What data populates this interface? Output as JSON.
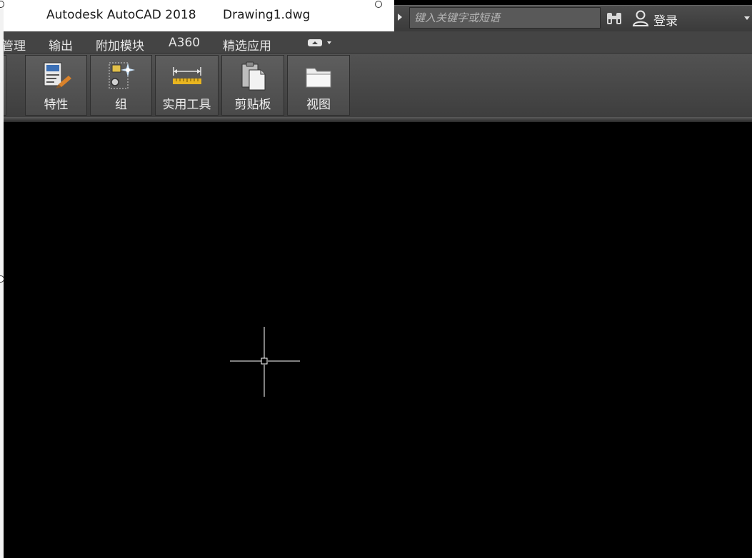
{
  "titlebar": {
    "app_title": "Autodesk AutoCAD 2018",
    "document_title": "Drawing1.dwg"
  },
  "search": {
    "placeholder": "键入关键字或短语"
  },
  "account": {
    "login_label": "登录"
  },
  "menu": {
    "items": [
      {
        "label": "管理"
      },
      {
        "label": "输出"
      },
      {
        "label": "附加模块"
      },
      {
        "label": "A360"
      },
      {
        "label": "精选应用"
      }
    ]
  },
  "ribbon": {
    "buttons": [
      {
        "label": "特性",
        "icon": "properties-icon"
      },
      {
        "label": "组",
        "icon": "group-icon"
      },
      {
        "label": "实用工具",
        "icon": "measure-icon"
      },
      {
        "label": "剪贴板",
        "icon": "clipboard-icon"
      },
      {
        "label": "视图",
        "icon": "view-folder-icon"
      }
    ]
  },
  "colors": {
    "canvas_background": "#000000",
    "ribbon_background": "#4a4a4a",
    "menubar_background": "#444444",
    "titlebar_background": "#ffffff",
    "text_light": "#f0f0f0",
    "crosshair": "#ffffff"
  }
}
